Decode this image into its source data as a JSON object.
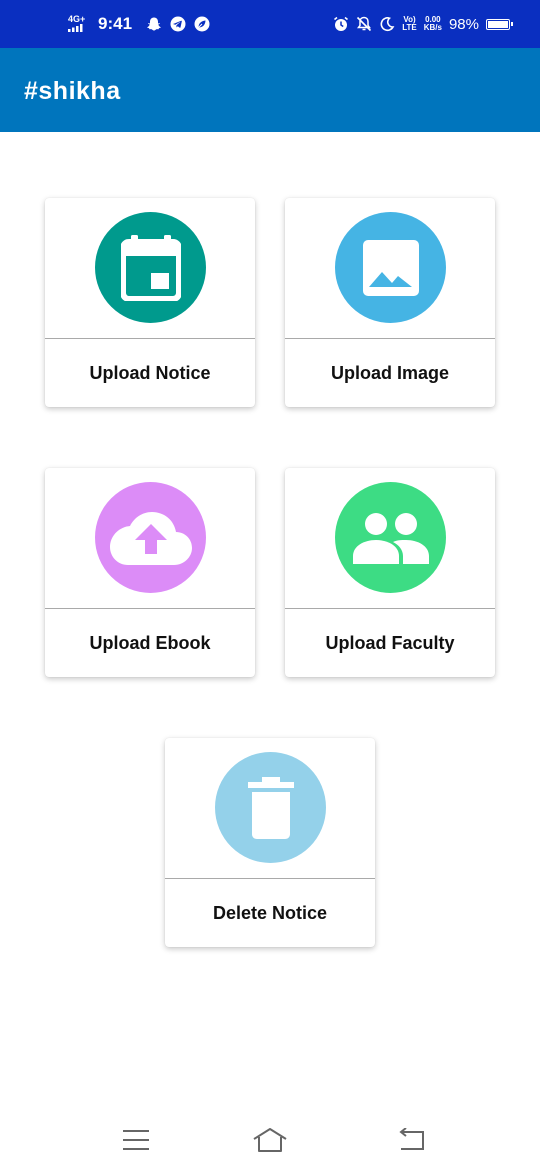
{
  "status_bar": {
    "network": "4G+",
    "time": "9:41",
    "volte_top": "Vo)",
    "volte_bottom": "LTE",
    "speed_value": "0.00",
    "speed_unit": "KB/s",
    "battery": "98%",
    "battery_level": 0.98,
    "left_icons": [
      "snapchat-icon",
      "telegram-icon",
      "leaf-icon"
    ],
    "right_icons": [
      "alarm-icon",
      "mute-icon",
      "moon-icon"
    ]
  },
  "app_bar": {
    "title": "#shikha"
  },
  "cards": [
    {
      "label": "Upload Notice",
      "icon": "calendar-icon",
      "color": "#009a8d"
    },
    {
      "label": "Upload Image",
      "icon": "image-icon",
      "color": "#45b4e4"
    },
    {
      "label": "Upload Ebook",
      "icon": "cloud-upload-icon",
      "color": "#dc8cf7"
    },
    {
      "label": "Upload Faculty",
      "icon": "group-icon",
      "color": "#3ddc84"
    },
    {
      "label": "Delete Notice",
      "icon": "delete-icon",
      "color": "#94d1ea"
    }
  ],
  "nav": {
    "icons": [
      "menu-icon",
      "home-icon",
      "back-icon"
    ]
  }
}
